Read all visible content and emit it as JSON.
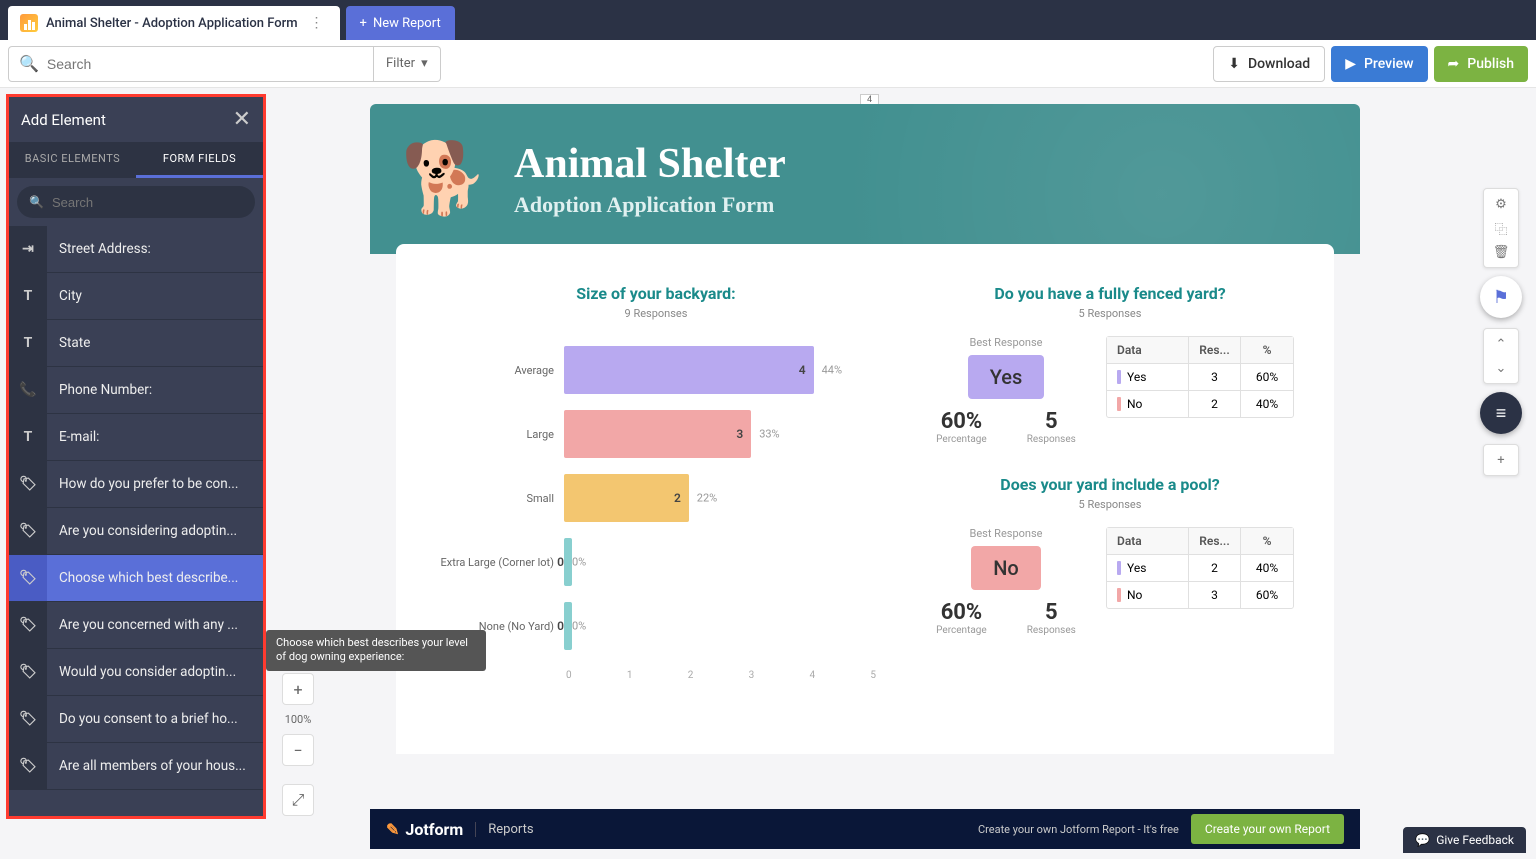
{
  "topbar": {
    "tab_title": "Animal Shelter - Adoption Application Form",
    "new_report": "New Report"
  },
  "toolbar": {
    "search_placeholder": "Search",
    "filter": "Filter",
    "download": "Download",
    "preview": "Preview",
    "publish": "Publish"
  },
  "panel": {
    "title": "Add Element",
    "tab_basic": "BASIC ELEMENTS",
    "tab_form": "FORM FIELDS",
    "search_placeholder": "Search",
    "fields": [
      {
        "icon": "indent-icon",
        "label": "Street Address:"
      },
      {
        "icon": "text-icon",
        "label": "City"
      },
      {
        "icon": "text-icon",
        "label": "State"
      },
      {
        "icon": "phone-icon",
        "label": "Phone Number:"
      },
      {
        "icon": "text-icon",
        "label": "E-mail:"
      },
      {
        "icon": "tag-icon",
        "label": "How do you prefer to be con..."
      },
      {
        "icon": "tag-icon",
        "label": "Are you considering adoptin..."
      },
      {
        "icon": "tag-icon",
        "label": "Choose which best describe...",
        "selected": true
      },
      {
        "icon": "tag-icon",
        "label": "Are you concerned with any ..."
      },
      {
        "icon": "tag-icon",
        "label": "Would you consider adoptin..."
      },
      {
        "icon": "tag-icon",
        "label": "Do you consent to a brief ho..."
      },
      {
        "icon": "tag-icon",
        "label": "Are all members of your hous..."
      }
    ],
    "tooltip": "Choose which best describes your level of dog owning experience:"
  },
  "zoom": {
    "pct": "100%"
  },
  "ruler_marker": "4",
  "report": {
    "title": "Animal Shelter",
    "subtitle": "Adoption Application Form"
  },
  "chart_data": [
    {
      "type": "bar",
      "orientation": "horizontal",
      "title": "Size of your backyard:",
      "subtitle": "9 Responses",
      "categories": [
        "Average",
        "Large",
        "Small",
        "Extra Large (Corner lot)",
        "None (No Yard)"
      ],
      "values": [
        4,
        3,
        2,
        0,
        0
      ],
      "percentages": [
        "44%",
        "33%",
        "22%",
        "0%",
        "0%"
      ],
      "colors": [
        "#b8a9f0",
        "#f2a7a7",
        "#f3c670",
        "#88cfcf",
        "#88cfcf"
      ],
      "xticks": [
        0,
        1,
        2,
        3,
        4,
        5
      ],
      "xlim": [
        0,
        5
      ]
    },
    {
      "type": "table",
      "title": "Do you have a fully fenced yard?",
      "subtitle": "5 Responses",
      "best_label": "Best Response",
      "best": "Yes",
      "best_color": "purple",
      "stats": [
        {
          "val": "60%",
          "lbl": "Percentage"
        },
        {
          "val": "5",
          "lbl": "Responses"
        }
      ],
      "headers": [
        "Data",
        "Res...",
        "%"
      ],
      "rows": [
        {
          "label": "Yes",
          "res": "3",
          "pct": "60%",
          "color": "#b8a9f0"
        },
        {
          "label": "No",
          "res": "2",
          "pct": "40%",
          "color": "#f2a7a7"
        }
      ]
    },
    {
      "type": "table",
      "title": "Does your yard include a pool?",
      "subtitle": "5 Responses",
      "best_label": "Best Response",
      "best": "No",
      "best_color": "pink",
      "stats": [
        {
          "val": "60%",
          "lbl": "Percentage"
        },
        {
          "val": "5",
          "lbl": "Responses"
        }
      ],
      "headers": [
        "Data",
        "Res...",
        "%"
      ],
      "rows": [
        {
          "label": "Yes",
          "res": "2",
          "pct": "40%",
          "color": "#b8a9f0"
        },
        {
          "label": "No",
          "res": "3",
          "pct": "60%",
          "color": "#f2a7a7"
        }
      ]
    }
  ],
  "footer": {
    "brand": "Jotform",
    "section": "Reports",
    "cta_text": "Create your own Jotform Report - It's free",
    "cta_btn": "Create your own Report"
  },
  "feedback": "Give Feedback"
}
